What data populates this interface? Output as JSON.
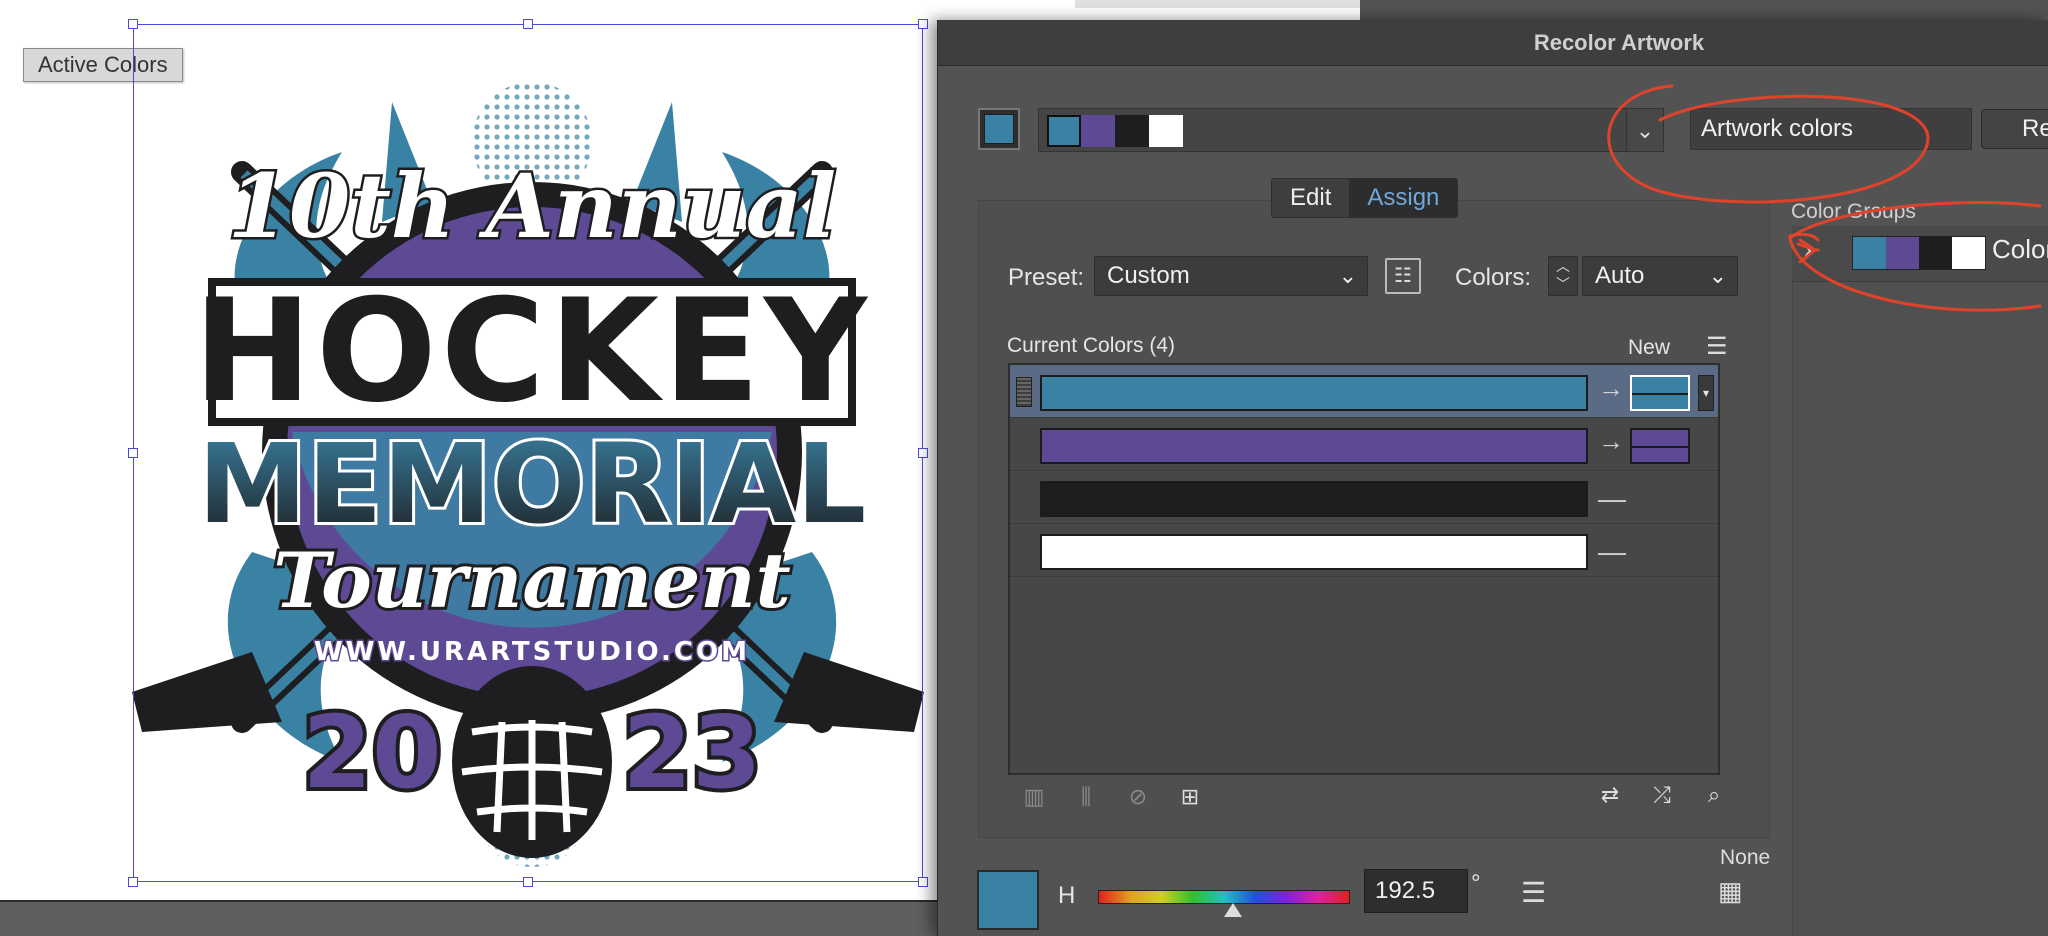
{
  "canvas": {
    "active_colors_label": "Active Colors",
    "artwork": {
      "line1": "10th Annual",
      "line2": "HOCKEY",
      "line3": "MEMORIAL",
      "line4": "Tournament",
      "url": "WWW.URARTSTUDIO.COM",
      "year_left": "20",
      "year_right": "23"
    }
  },
  "dialog": {
    "title": "Recolor Artwork",
    "harmony_dropdown_icon": "chevron-down-icon",
    "artwork_colors_value": "Artwork colors",
    "reset_button_label": "Re",
    "tabs": [
      {
        "label": "Edit",
        "active": false
      },
      {
        "label": "Assign",
        "active": true
      }
    ],
    "preset_label": "Preset:",
    "preset_value": "Custom",
    "colors_label": "Colors:",
    "colors_value": "Auto",
    "current_colors_label": "Current Colors (4)",
    "new_label": "New",
    "current_colors": [
      {
        "color": "#3a82a4",
        "new": "#3a82a4",
        "selected": true,
        "mapped": true
      },
      {
        "color": "#5e4a94",
        "new": "#5e4a94",
        "selected": false,
        "mapped": true
      },
      {
        "color": "#1e1e20",
        "new": null,
        "selected": false,
        "mapped": false
      },
      {
        "color": "#ffffff",
        "new": null,
        "selected": false,
        "mapped": false
      }
    ],
    "color_groups_label": "Color Groups",
    "color_group_name": "Color",
    "color_group_swatches": [
      "#3a82a4",
      "#5e4a94",
      "#1e1e20",
      "#ffffff"
    ],
    "hue_label": "H",
    "hue_value": "192.5",
    "hue_unit": "°",
    "hue_fraction": 0.535,
    "none_label": "None",
    "accent_color": "#3a82a4",
    "annotation_color": "#e0432b"
  }
}
